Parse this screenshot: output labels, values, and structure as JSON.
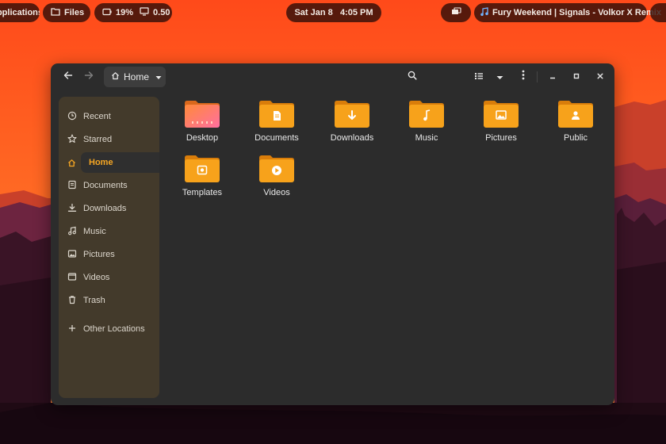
{
  "topbar": {
    "apps_label": "Applications",
    "files_label": "Files",
    "battery": "19%",
    "load": "0.50",
    "clock": "Sat Jan 8   4:05 PM",
    "media": "Fury Weekend | Signals - Volkor X Remix"
  },
  "window": {
    "path_label": "Home"
  },
  "sidebar": {
    "items": [
      {
        "label": "Recent",
        "icon": "clock-icon"
      },
      {
        "label": "Starred",
        "icon": "star-icon"
      },
      {
        "label": "Home",
        "icon": "home-icon"
      },
      {
        "label": "Documents",
        "icon": "document-icon"
      },
      {
        "label": "Downloads",
        "icon": "download-icon"
      },
      {
        "label": "Music",
        "icon": "music-icon"
      },
      {
        "label": "Pictures",
        "icon": "picture-icon"
      },
      {
        "label": "Videos",
        "icon": "video-icon"
      },
      {
        "label": "Trash",
        "icon": "trash-icon"
      },
      {
        "label": "Other Locations",
        "icon": "plus-icon"
      }
    ],
    "active": "Home"
  },
  "folders": [
    {
      "label": "Desktop",
      "icon": "desktop-folder-icon"
    },
    {
      "label": "Documents",
      "icon": "documents-folder-icon"
    },
    {
      "label": "Downloads",
      "icon": "downloads-folder-icon"
    },
    {
      "label": "Music",
      "icon": "music-folder-icon"
    },
    {
      "label": "Pictures",
      "icon": "pictures-folder-icon"
    },
    {
      "label": "Public",
      "icon": "public-folder-icon"
    },
    {
      "label": "Templates",
      "icon": "templates-folder-icon"
    },
    {
      "label": "Videos",
      "icon": "videos-folder-icon"
    }
  ],
  "colors": {
    "accent": "#f5a623",
    "folder": "#f59a12",
    "sky_top": "#ff4f1c",
    "sky_bottom": "#fd7a2c"
  }
}
